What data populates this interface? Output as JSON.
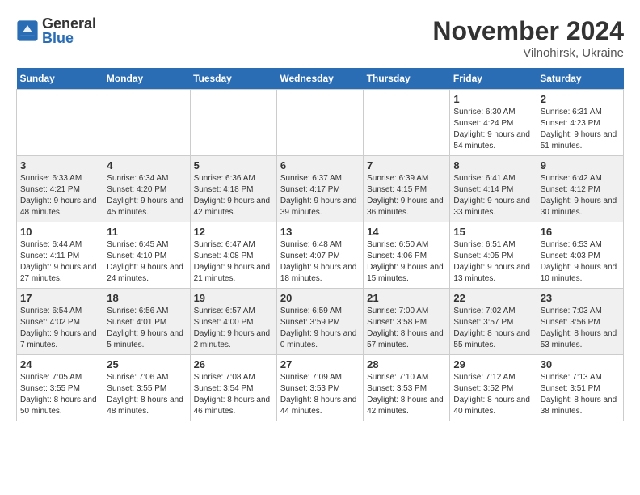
{
  "header": {
    "logo_general": "General",
    "logo_blue": "Blue",
    "month_title": "November 2024",
    "location": "Vilnohirsk, Ukraine"
  },
  "days_of_week": [
    "Sunday",
    "Monday",
    "Tuesday",
    "Wednesday",
    "Thursday",
    "Friday",
    "Saturday"
  ],
  "weeks": [
    {
      "days": [
        {
          "number": "",
          "info": "",
          "empty": true
        },
        {
          "number": "",
          "info": "",
          "empty": true
        },
        {
          "number": "",
          "info": "",
          "empty": true
        },
        {
          "number": "",
          "info": "",
          "empty": true
        },
        {
          "number": "",
          "info": "",
          "empty": true
        },
        {
          "number": "1",
          "info": "Sunrise: 6:30 AM\nSunset: 4:24 PM\nDaylight: 9 hours and 54 minutes."
        },
        {
          "number": "2",
          "info": "Sunrise: 6:31 AM\nSunset: 4:23 PM\nDaylight: 9 hours and 51 minutes."
        }
      ]
    },
    {
      "days": [
        {
          "number": "3",
          "info": "Sunrise: 6:33 AM\nSunset: 4:21 PM\nDaylight: 9 hours and 48 minutes."
        },
        {
          "number": "4",
          "info": "Sunrise: 6:34 AM\nSunset: 4:20 PM\nDaylight: 9 hours and 45 minutes."
        },
        {
          "number": "5",
          "info": "Sunrise: 6:36 AM\nSunset: 4:18 PM\nDaylight: 9 hours and 42 minutes."
        },
        {
          "number": "6",
          "info": "Sunrise: 6:37 AM\nSunset: 4:17 PM\nDaylight: 9 hours and 39 minutes."
        },
        {
          "number": "7",
          "info": "Sunrise: 6:39 AM\nSunset: 4:15 PM\nDaylight: 9 hours and 36 minutes."
        },
        {
          "number": "8",
          "info": "Sunrise: 6:41 AM\nSunset: 4:14 PM\nDaylight: 9 hours and 33 minutes."
        },
        {
          "number": "9",
          "info": "Sunrise: 6:42 AM\nSunset: 4:12 PM\nDaylight: 9 hours and 30 minutes."
        }
      ]
    },
    {
      "days": [
        {
          "number": "10",
          "info": "Sunrise: 6:44 AM\nSunset: 4:11 PM\nDaylight: 9 hours and 27 minutes."
        },
        {
          "number": "11",
          "info": "Sunrise: 6:45 AM\nSunset: 4:10 PM\nDaylight: 9 hours and 24 minutes."
        },
        {
          "number": "12",
          "info": "Sunrise: 6:47 AM\nSunset: 4:08 PM\nDaylight: 9 hours and 21 minutes."
        },
        {
          "number": "13",
          "info": "Sunrise: 6:48 AM\nSunset: 4:07 PM\nDaylight: 9 hours and 18 minutes."
        },
        {
          "number": "14",
          "info": "Sunrise: 6:50 AM\nSunset: 4:06 PM\nDaylight: 9 hours and 15 minutes."
        },
        {
          "number": "15",
          "info": "Sunrise: 6:51 AM\nSunset: 4:05 PM\nDaylight: 9 hours and 13 minutes."
        },
        {
          "number": "16",
          "info": "Sunrise: 6:53 AM\nSunset: 4:03 PM\nDaylight: 9 hours and 10 minutes."
        }
      ]
    },
    {
      "days": [
        {
          "number": "17",
          "info": "Sunrise: 6:54 AM\nSunset: 4:02 PM\nDaylight: 9 hours and 7 minutes."
        },
        {
          "number": "18",
          "info": "Sunrise: 6:56 AM\nSunset: 4:01 PM\nDaylight: 9 hours and 5 minutes."
        },
        {
          "number": "19",
          "info": "Sunrise: 6:57 AM\nSunset: 4:00 PM\nDaylight: 9 hours and 2 minutes."
        },
        {
          "number": "20",
          "info": "Sunrise: 6:59 AM\nSunset: 3:59 PM\nDaylight: 9 hours and 0 minutes."
        },
        {
          "number": "21",
          "info": "Sunrise: 7:00 AM\nSunset: 3:58 PM\nDaylight: 8 hours and 57 minutes."
        },
        {
          "number": "22",
          "info": "Sunrise: 7:02 AM\nSunset: 3:57 PM\nDaylight: 8 hours and 55 minutes."
        },
        {
          "number": "23",
          "info": "Sunrise: 7:03 AM\nSunset: 3:56 PM\nDaylight: 8 hours and 53 minutes."
        }
      ]
    },
    {
      "days": [
        {
          "number": "24",
          "info": "Sunrise: 7:05 AM\nSunset: 3:55 PM\nDaylight: 8 hours and 50 minutes."
        },
        {
          "number": "25",
          "info": "Sunrise: 7:06 AM\nSunset: 3:55 PM\nDaylight: 8 hours and 48 minutes."
        },
        {
          "number": "26",
          "info": "Sunrise: 7:08 AM\nSunset: 3:54 PM\nDaylight: 8 hours and 46 minutes."
        },
        {
          "number": "27",
          "info": "Sunrise: 7:09 AM\nSunset: 3:53 PM\nDaylight: 8 hours and 44 minutes."
        },
        {
          "number": "28",
          "info": "Sunrise: 7:10 AM\nSunset: 3:53 PM\nDaylight: 8 hours and 42 minutes."
        },
        {
          "number": "29",
          "info": "Sunrise: 7:12 AM\nSunset: 3:52 PM\nDaylight: 8 hours and 40 minutes."
        },
        {
          "number": "30",
          "info": "Sunrise: 7:13 AM\nSunset: 3:51 PM\nDaylight: 8 hours and 38 minutes."
        }
      ]
    }
  ]
}
